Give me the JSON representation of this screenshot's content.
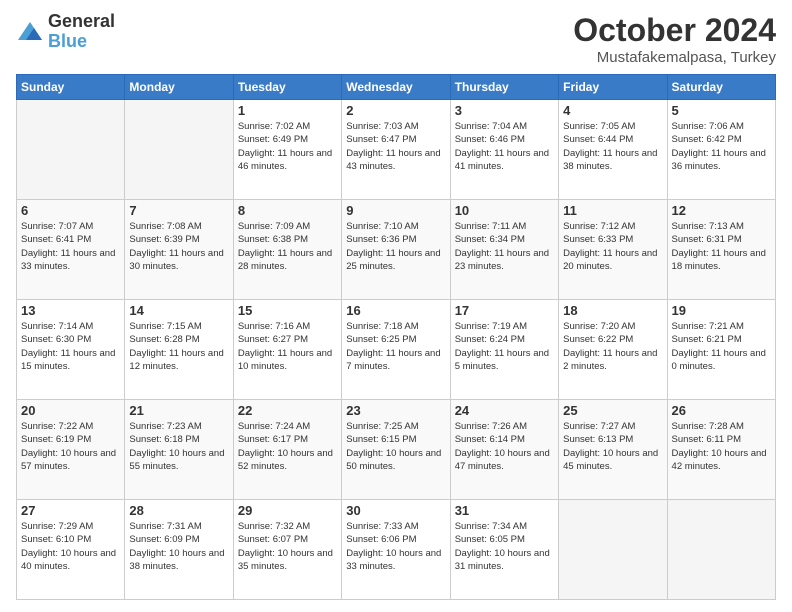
{
  "header": {
    "logo_line1": "General",
    "logo_line2": "Blue",
    "month": "October 2024",
    "location": "Mustafakemalpasa, Turkey"
  },
  "days_of_week": [
    "Sunday",
    "Monday",
    "Tuesday",
    "Wednesday",
    "Thursday",
    "Friday",
    "Saturday"
  ],
  "weeks": [
    [
      {
        "day": "",
        "empty": true
      },
      {
        "day": "",
        "empty": true
      },
      {
        "day": "1",
        "sunrise": "Sunrise: 7:02 AM",
        "sunset": "Sunset: 6:49 PM",
        "daylight": "Daylight: 11 hours and 46 minutes."
      },
      {
        "day": "2",
        "sunrise": "Sunrise: 7:03 AM",
        "sunset": "Sunset: 6:47 PM",
        "daylight": "Daylight: 11 hours and 43 minutes."
      },
      {
        "day": "3",
        "sunrise": "Sunrise: 7:04 AM",
        "sunset": "Sunset: 6:46 PM",
        "daylight": "Daylight: 11 hours and 41 minutes."
      },
      {
        "day": "4",
        "sunrise": "Sunrise: 7:05 AM",
        "sunset": "Sunset: 6:44 PM",
        "daylight": "Daylight: 11 hours and 38 minutes."
      },
      {
        "day": "5",
        "sunrise": "Sunrise: 7:06 AM",
        "sunset": "Sunset: 6:42 PM",
        "daylight": "Daylight: 11 hours and 36 minutes."
      }
    ],
    [
      {
        "day": "6",
        "sunrise": "Sunrise: 7:07 AM",
        "sunset": "Sunset: 6:41 PM",
        "daylight": "Daylight: 11 hours and 33 minutes."
      },
      {
        "day": "7",
        "sunrise": "Sunrise: 7:08 AM",
        "sunset": "Sunset: 6:39 PM",
        "daylight": "Daylight: 11 hours and 30 minutes."
      },
      {
        "day": "8",
        "sunrise": "Sunrise: 7:09 AM",
        "sunset": "Sunset: 6:38 PM",
        "daylight": "Daylight: 11 hours and 28 minutes."
      },
      {
        "day": "9",
        "sunrise": "Sunrise: 7:10 AM",
        "sunset": "Sunset: 6:36 PM",
        "daylight": "Daylight: 11 hours and 25 minutes."
      },
      {
        "day": "10",
        "sunrise": "Sunrise: 7:11 AM",
        "sunset": "Sunset: 6:34 PM",
        "daylight": "Daylight: 11 hours and 23 minutes."
      },
      {
        "day": "11",
        "sunrise": "Sunrise: 7:12 AM",
        "sunset": "Sunset: 6:33 PM",
        "daylight": "Daylight: 11 hours and 20 minutes."
      },
      {
        "day": "12",
        "sunrise": "Sunrise: 7:13 AM",
        "sunset": "Sunset: 6:31 PM",
        "daylight": "Daylight: 11 hours and 18 minutes."
      }
    ],
    [
      {
        "day": "13",
        "sunrise": "Sunrise: 7:14 AM",
        "sunset": "Sunset: 6:30 PM",
        "daylight": "Daylight: 11 hours and 15 minutes."
      },
      {
        "day": "14",
        "sunrise": "Sunrise: 7:15 AM",
        "sunset": "Sunset: 6:28 PM",
        "daylight": "Daylight: 11 hours and 12 minutes."
      },
      {
        "day": "15",
        "sunrise": "Sunrise: 7:16 AM",
        "sunset": "Sunset: 6:27 PM",
        "daylight": "Daylight: 11 hours and 10 minutes."
      },
      {
        "day": "16",
        "sunrise": "Sunrise: 7:18 AM",
        "sunset": "Sunset: 6:25 PM",
        "daylight": "Daylight: 11 hours and 7 minutes."
      },
      {
        "day": "17",
        "sunrise": "Sunrise: 7:19 AM",
        "sunset": "Sunset: 6:24 PM",
        "daylight": "Daylight: 11 hours and 5 minutes."
      },
      {
        "day": "18",
        "sunrise": "Sunrise: 7:20 AM",
        "sunset": "Sunset: 6:22 PM",
        "daylight": "Daylight: 11 hours and 2 minutes."
      },
      {
        "day": "19",
        "sunrise": "Sunrise: 7:21 AM",
        "sunset": "Sunset: 6:21 PM",
        "daylight": "Daylight: 11 hours and 0 minutes."
      }
    ],
    [
      {
        "day": "20",
        "sunrise": "Sunrise: 7:22 AM",
        "sunset": "Sunset: 6:19 PM",
        "daylight": "Daylight: 10 hours and 57 minutes."
      },
      {
        "day": "21",
        "sunrise": "Sunrise: 7:23 AM",
        "sunset": "Sunset: 6:18 PM",
        "daylight": "Daylight: 10 hours and 55 minutes."
      },
      {
        "day": "22",
        "sunrise": "Sunrise: 7:24 AM",
        "sunset": "Sunset: 6:17 PM",
        "daylight": "Daylight: 10 hours and 52 minutes."
      },
      {
        "day": "23",
        "sunrise": "Sunrise: 7:25 AM",
        "sunset": "Sunset: 6:15 PM",
        "daylight": "Daylight: 10 hours and 50 minutes."
      },
      {
        "day": "24",
        "sunrise": "Sunrise: 7:26 AM",
        "sunset": "Sunset: 6:14 PM",
        "daylight": "Daylight: 10 hours and 47 minutes."
      },
      {
        "day": "25",
        "sunrise": "Sunrise: 7:27 AM",
        "sunset": "Sunset: 6:13 PM",
        "daylight": "Daylight: 10 hours and 45 minutes."
      },
      {
        "day": "26",
        "sunrise": "Sunrise: 7:28 AM",
        "sunset": "Sunset: 6:11 PM",
        "daylight": "Daylight: 10 hours and 42 minutes."
      }
    ],
    [
      {
        "day": "27",
        "sunrise": "Sunrise: 7:29 AM",
        "sunset": "Sunset: 6:10 PM",
        "daylight": "Daylight: 10 hours and 40 minutes."
      },
      {
        "day": "28",
        "sunrise": "Sunrise: 7:31 AM",
        "sunset": "Sunset: 6:09 PM",
        "daylight": "Daylight: 10 hours and 38 minutes."
      },
      {
        "day": "29",
        "sunrise": "Sunrise: 7:32 AM",
        "sunset": "Sunset: 6:07 PM",
        "daylight": "Daylight: 10 hours and 35 minutes."
      },
      {
        "day": "30",
        "sunrise": "Sunrise: 7:33 AM",
        "sunset": "Sunset: 6:06 PM",
        "daylight": "Daylight: 10 hours and 33 minutes."
      },
      {
        "day": "31",
        "sunrise": "Sunrise: 7:34 AM",
        "sunset": "Sunset: 6:05 PM",
        "daylight": "Daylight: 10 hours and 31 minutes."
      },
      {
        "day": "",
        "empty": true
      },
      {
        "day": "",
        "empty": true
      }
    ]
  ]
}
